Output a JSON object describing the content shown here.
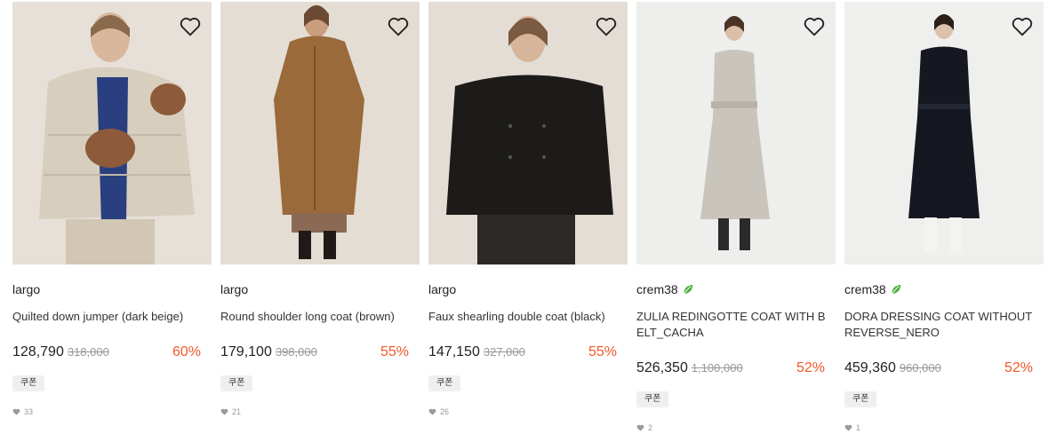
{
  "products": [
    {
      "brand": "largo",
      "name": "Quilted down jumper (dark beige)",
      "price": "128,790",
      "original_price": "318,000",
      "discount": "60%",
      "coupon": "쿠폰",
      "likes": "33",
      "leaf_badge": false,
      "image": {
        "bg": "#e6e0d8",
        "garment": "#d7cebe",
        "accent": "#2a3f7f",
        "alt": "Quilted down jumper"
      }
    },
    {
      "brand": "largo",
      "name": "Round shoulder long coat (brown)",
      "price": "179,100",
      "original_price": "398,000",
      "discount": "55%",
      "coupon": "쿠폰",
      "likes": "21",
      "leaf_badge": false,
      "image": {
        "bg": "#e4ddd3",
        "garment": "#9a6a3a",
        "accent": "#1f1a17",
        "alt": "Round shoulder long coat"
      }
    },
    {
      "brand": "largo",
      "name": "Faux shearling double coat (black)",
      "price": "147,150",
      "original_price": "327,000",
      "discount": "55%",
      "coupon": "쿠폰",
      "likes": "26",
      "leaf_badge": false,
      "image": {
        "bg": "#e3ddd5",
        "garment": "#1c1b19",
        "accent": "#2b2a28",
        "alt": "Faux shearling double coat"
      }
    },
    {
      "brand": "crem38",
      "name": "ZULIA REDINGOTTE COAT WITH BELT_CACHA",
      "price": "526,350",
      "original_price": "1,100,000",
      "discount": "52%",
      "coupon": "쿠폰",
      "likes": "2",
      "leaf_badge": true,
      "image": {
        "bg": "#eeeeec",
        "garment": "#c9c5bd",
        "accent": "#2a2a2a",
        "alt": "Zulia redingotte coat"
      }
    },
    {
      "brand": "crem38",
      "name": "DORA DRESSING COAT WITHOUT REVERSE_NERO",
      "price": "459,360",
      "original_price": "960,000",
      "discount": "52%",
      "coupon": "쿠폰",
      "likes": "1",
      "leaf_badge": true,
      "image": {
        "bg": "#efefed",
        "garment": "#151821",
        "accent": "#f3f3ef",
        "alt": "Dora dressing coat"
      }
    }
  ],
  "colors": {
    "discount": "#f05a28",
    "leaf": "#4caf3c",
    "coupon_bg": "#efefef"
  },
  "icons": {
    "wishlist": "heart-outline-icon",
    "likes": "heart-filled-icon",
    "eco": "leaf-icon"
  }
}
